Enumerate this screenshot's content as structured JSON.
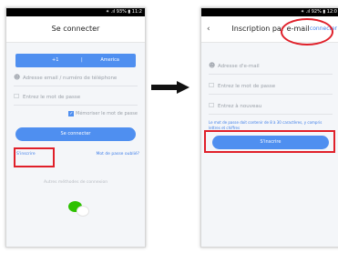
{
  "left": {
    "status": "✴ .ıl 93% ▮ 11:2",
    "title": "Se connecter",
    "country_code": "+1",
    "country_name": "America",
    "email_placeholder": "Adresse email / numéro de téléphone",
    "password_placeholder": "Entrez le mot de passe",
    "remember_label": "Mémoriser le mot de passe",
    "connect_button": "Se connecter",
    "register_link": "S'inscrire",
    "forgot_link": "Mot de passe oublié?",
    "other_methods": "Autres méthodes de connexion"
  },
  "right": {
    "status": "✴ .ıl 92% ▮ 12:0",
    "title": "Inscription par e-mail",
    "connect_link": "connecter",
    "email_placeholder": "Adresse d'e-mail",
    "password_placeholder": "Entrez le mot de passe",
    "repeat_placeholder": "Entrez à nouveau",
    "hint": "Le mot de passe doit contenir de 8 à 30 caractères, y compris lettres et chiffres",
    "register_button": "S'inscrire"
  },
  "colors": {
    "accent": "#4f8ff0",
    "highlight": "#e0202a",
    "link": "#3e7ee8"
  },
  "icons": [
    "back-icon",
    "user-icon",
    "lock-icon",
    "checkbox-icon",
    "wechat-icon",
    "arrow-right-icon"
  ]
}
